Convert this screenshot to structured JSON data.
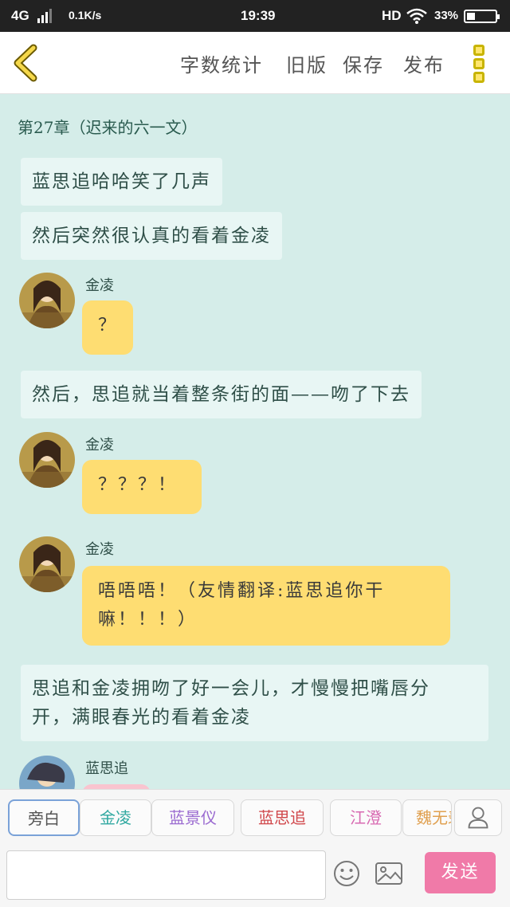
{
  "status_bar": {
    "network": "4G",
    "speed": "0.1K/s",
    "time": "19:39",
    "hd": "HD",
    "battery": "33%"
  },
  "toolbar": {
    "word_count": "字数统计",
    "old_version": "旧版",
    "save": "保存",
    "publish": "发布"
  },
  "chapter_title": "第27章（迟来的六一文）",
  "messages": [
    {
      "type": "narration",
      "text": "蓝思追哈哈笑了几声"
    },
    {
      "type": "narration",
      "text": "然后突然很认真的看着金凌"
    },
    {
      "type": "bubble",
      "speaker": "金凌",
      "text": "？"
    },
    {
      "type": "narration",
      "text": "然后，思追就当着整条街的面——吻了下去"
    },
    {
      "type": "bubble",
      "speaker": "金凌",
      "text": "？？？！"
    },
    {
      "type": "bubble",
      "speaker": "金凌",
      "text_line1": "唔唔唔！（友情翻译:蓝思追你干",
      "text_line2": "嘛！！！）"
    },
    {
      "type": "narration",
      "text_line1": "思追和金凌拥吻了好一会儿，才慢慢把嘴唇分",
      "text_line2": "开，满眼春光的看着金凌"
    },
    {
      "type": "bubble",
      "speaker": "蓝思追",
      "text": ""
    }
  ],
  "characters": [
    {
      "label": "旁白",
      "color": "#555555"
    },
    {
      "label": "金凌",
      "color": "#2fa8a0"
    },
    {
      "label": "蓝景仪",
      "color": "#9a6ad0"
    },
    {
      "label": "蓝思追",
      "color": "#d0464a"
    },
    {
      "label": "江澄",
      "color": "#d86ab2"
    },
    {
      "label": "魏无羡",
      "color": "#e0a050"
    }
  ],
  "composer": {
    "placeholder": "",
    "send_label": "发送"
  },
  "colors": {
    "background": "#d5ede9",
    "bubble": "#fedd72",
    "send": "#f07aa8"
  }
}
